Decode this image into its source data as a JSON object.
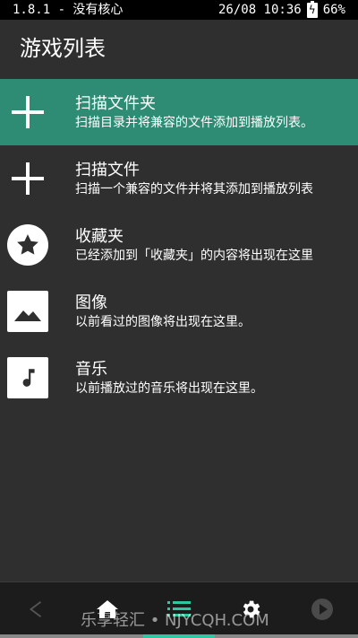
{
  "status_bar": {
    "left": "1.8.1 - 没有核心",
    "time": "26/08 10:36",
    "battery": "66%"
  },
  "appbar": {
    "title": "游戏列表"
  },
  "items": [
    {
      "label": "扫描文件夹",
      "desc": "扫描目录并将兼容的文件添加到播放列表。",
      "icon": "plus-icon"
    },
    {
      "label": "扫描文件",
      "desc": "扫描一个兼容的文件并将其添加到播放列表",
      "icon": "plus-icon"
    },
    {
      "label": "收藏夹",
      "desc": "已经添加到「收藏夹」的内容将出现在这里",
      "icon": "star-icon"
    },
    {
      "label": "图像",
      "desc": "以前看过的图像将出现在这里。",
      "icon": "image-icon"
    },
    {
      "label": "音乐",
      "desc": "以前播放过的音乐将出现在这里。",
      "icon": "music-note-icon"
    }
  ],
  "bottom_nav": {
    "icons": [
      "back-icon",
      "home-icon",
      "list-icon",
      "gear-icon",
      "play-icon"
    ],
    "active": "list-icon"
  },
  "watermark": "乐享轻汇 • NJYCQH.COM",
  "colors": {
    "accent": "#2e8b74",
    "background": "#2f2f2f",
    "status_bar": "#000000",
    "bottom_bar": "#1c1c1c",
    "indicator": "#2fc7a1"
  }
}
